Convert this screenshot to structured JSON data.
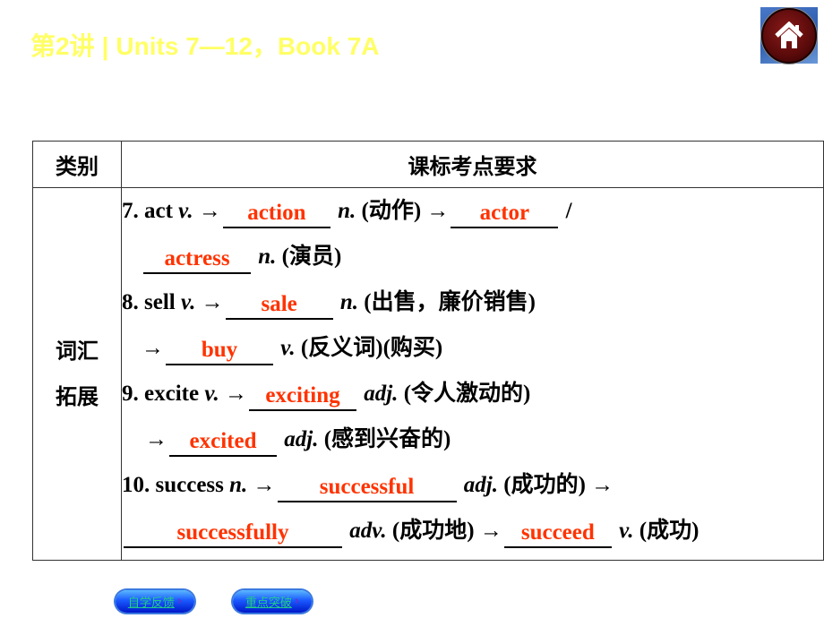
{
  "header": {
    "lecture": "第2讲",
    "separator": "|",
    "subtitle": "Units 7—12，Book 7A",
    "home_icon": "home-icon"
  },
  "table": {
    "headers": [
      "类别",
      "课标考点要求"
    ],
    "category_line1": "词汇",
    "category_line2": "拓展",
    "lines": [
      {
        "pre": "7. act ",
        "pos1": "v.",
        "arrow": " →",
        "ans1": "action",
        "pos2": " n.",
        "post": " (动作) →",
        "ans2": "actor",
        "tail": " /"
      },
      {
        "ans1": "actress",
        "pos1": " n.",
        "post": " (演员)"
      },
      {
        "pre": "8. sell ",
        "pos1": "v.",
        "arrow": " →",
        "ans1": "sale",
        "pos2": " n.",
        "post": " (出售，廉价销售)"
      },
      {
        "arrow": "→",
        "ans1": "buy",
        "pos1": " v.",
        "post": " (反义词)(购买)"
      },
      {
        "pre": "9. excite ",
        "pos1": "v.",
        "arrow": " →",
        "ans1": "exciting",
        "pos2": " adj.",
        "post": " (令人激动的)"
      },
      {
        "arrow": "→",
        "ans1": "excited",
        "pos1": " adj.",
        "post": " (感到兴奋的)"
      },
      {
        "pre": "10. success ",
        "pos1": "n.",
        "arrow": " →",
        "ans1": "successful",
        "pos2": " adj.",
        "post": " (成功的) →"
      },
      {
        "ans1": "successfully",
        "pos1": " adv.",
        "post": " (成功地) →",
        "ans2": "succeed",
        "pos2": " v.",
        "tail": " (成功)"
      }
    ]
  },
  "footer": {
    "buttons": [
      {
        "label": "自学反馈",
        "arrow": "›"
      },
      {
        "label": "重点突破",
        "arrow": "›"
      }
    ]
  },
  "colors": {
    "title": "#ffff66",
    "answer": "#ff3300"
  }
}
